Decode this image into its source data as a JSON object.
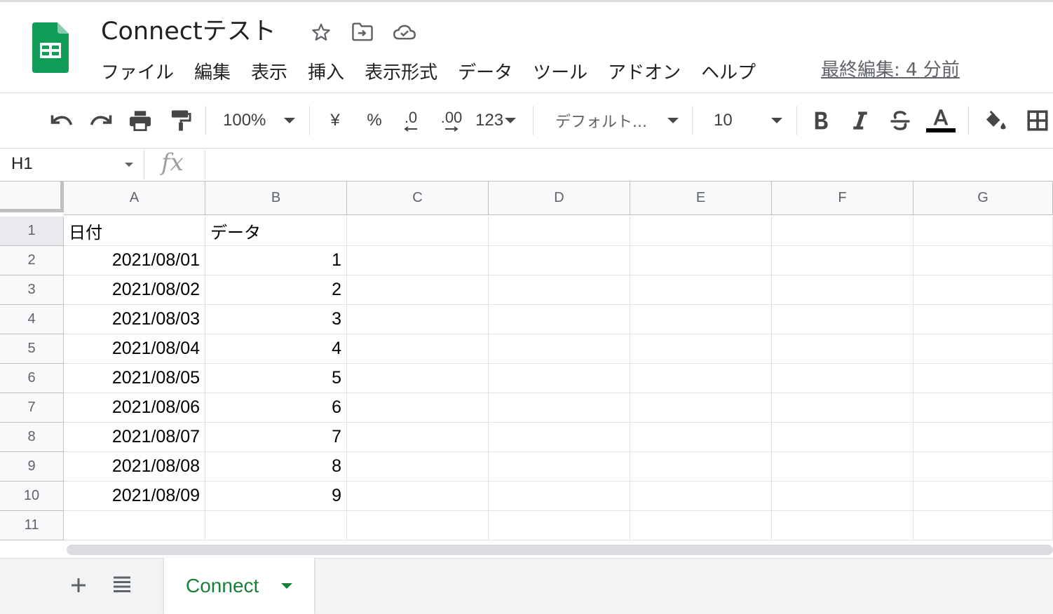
{
  "document": {
    "title": "Connectテスト",
    "last_edit": "最終編集: 4 分前"
  },
  "menu": [
    "ファイル",
    "編集",
    "表示",
    "挿入",
    "表示形式",
    "データ",
    "ツール",
    "アドオン",
    "ヘルプ"
  ],
  "toolbar": {
    "zoom": "100%",
    "currency_label": "¥",
    "percent_label": "%",
    "decrease_decimal_label": ".0",
    "increase_decimal_label": ".00",
    "more_formats_label": "123",
    "font": "デフォルト...",
    "font_size": "10",
    "text_color": "#000000"
  },
  "formula_bar": {
    "name_box": "H1",
    "fx_label": "fx",
    "value": ""
  },
  "grid": {
    "columns": [
      "A",
      "B",
      "C",
      "D",
      "E",
      "F",
      "G"
    ],
    "rows": [
      {
        "num": "1",
        "cells": [
          "日付",
          "データ"
        ]
      },
      {
        "num": "2",
        "cells": [
          "2021/08/01",
          "1"
        ]
      },
      {
        "num": "3",
        "cells": [
          "2021/08/02",
          "2"
        ]
      },
      {
        "num": "4",
        "cells": [
          "2021/08/03",
          "3"
        ]
      },
      {
        "num": "5",
        "cells": [
          "2021/08/04",
          "4"
        ]
      },
      {
        "num": "6",
        "cells": [
          "2021/08/05",
          "5"
        ]
      },
      {
        "num": "7",
        "cells": [
          "2021/08/06",
          "6"
        ]
      },
      {
        "num": "8",
        "cells": [
          "2021/08/07",
          "7"
        ]
      },
      {
        "num": "9",
        "cells": [
          "2021/08/08",
          "8"
        ]
      },
      {
        "num": "10",
        "cells": [
          "2021/08/09",
          "9"
        ]
      },
      {
        "num": "11",
        "cells": [
          "",
          ""
        ]
      }
    ]
  },
  "sheets": {
    "tabs": [
      {
        "label": "Connect",
        "active": true
      }
    ]
  },
  "colors": {
    "brand_green": "#0f9d58",
    "active_tab_text": "#188038",
    "grid_line": "#e2e2e2",
    "header_bg": "#f8f9fa"
  },
  "icons": [
    "sheets-logo",
    "star-icon",
    "move-to-folder-icon",
    "cloud-saved-icon",
    "undo-icon",
    "redo-icon",
    "print-icon",
    "paint-format-icon",
    "bold-icon",
    "italic-icon",
    "strikethrough-icon",
    "text-color-icon",
    "fill-color-icon",
    "borders-icon",
    "add-sheet-icon",
    "all-sheets-icon"
  ]
}
